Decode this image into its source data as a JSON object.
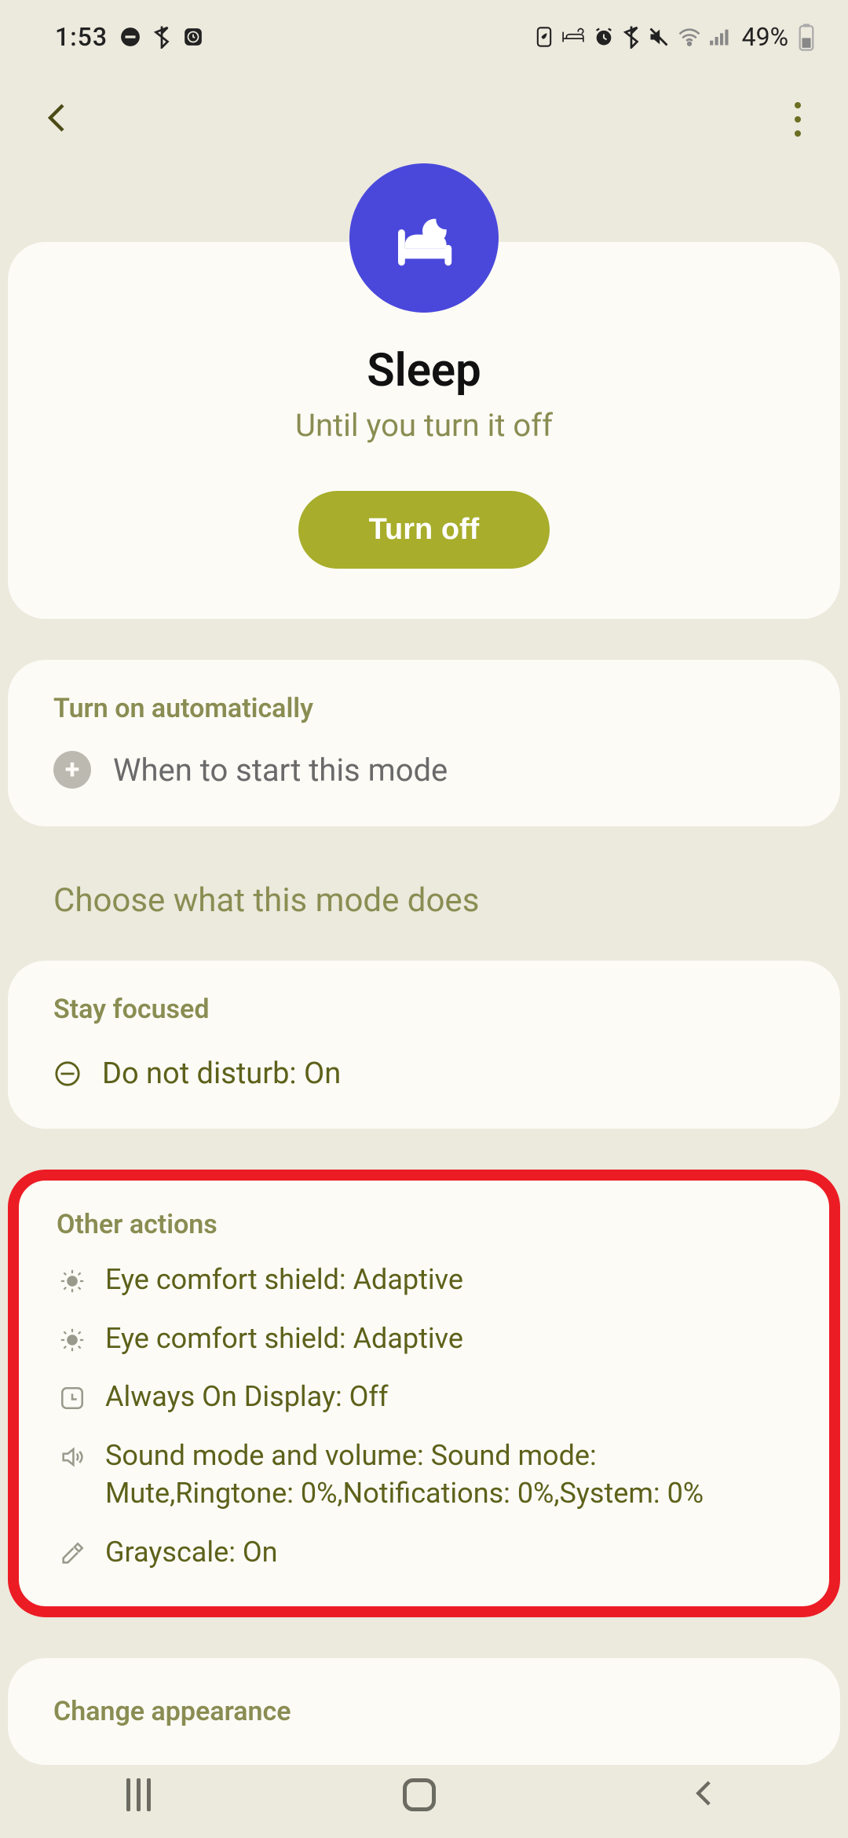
{
  "status": {
    "time": "1:53",
    "battery": "49%"
  },
  "hero": {
    "title": "Sleep",
    "subtitle": "Until you turn it off",
    "button": "Turn off"
  },
  "auto": {
    "heading": "Turn on automatically",
    "add_label": "When to start this mode"
  },
  "section_choose": "Choose what this mode does",
  "stay_focused": {
    "heading": "Stay focused",
    "dnd": "Do not disturb: On"
  },
  "other": {
    "heading": "Other actions",
    "items": {
      "0": "Eye comfort shield: Adaptive",
      "1": "Eye comfort shield: Adaptive",
      "2": "Always On Display: Off",
      "3": "Sound mode and volume: Sound mode: Mute,Ringtone: 0%,Notifications: 0%,System: 0%",
      "4": "Grayscale: On"
    }
  },
  "appearance": {
    "heading": "Change appearance"
  }
}
